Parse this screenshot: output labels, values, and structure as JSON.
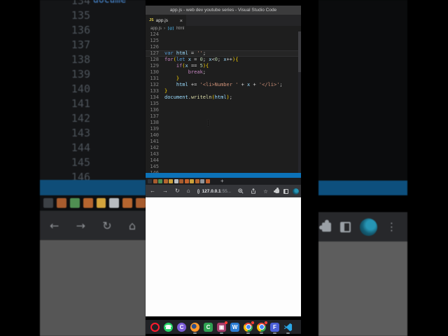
{
  "window": {
    "title": "app.js - web dev youtube series - Visual Studio Code"
  },
  "vscode": {
    "tab": {
      "badge": "JS",
      "label": "app.js",
      "close": "×"
    },
    "breadcrumb": {
      "file": "app.js",
      "sep": "›",
      "symbol_icon": "[@]",
      "symbol": "html"
    },
    "status_color": "#0c72b8",
    "editor": {
      "cursor_line": 127,
      "lines": [
        {
          "n": 124,
          "tokens": []
        },
        {
          "n": 125,
          "tokens": []
        },
        {
          "n": 126,
          "tokens": []
        },
        {
          "n": 127,
          "tokens": [
            [
              "k",
              "var "
            ],
            [
              "v",
              "html"
            ],
            [
              "d",
              " = "
            ],
            [
              "s",
              "''"
            ],
            [
              "d",
              ";"
            ]
          ]
        },
        {
          "n": 128,
          "tokens": [
            [
              "c",
              "for"
            ],
            [
              "b",
              "("
            ],
            [
              "k",
              "let "
            ],
            [
              "v",
              "x"
            ],
            [
              "d",
              " = "
            ],
            [
              "n",
              "0"
            ],
            [
              "d",
              "; "
            ],
            [
              "v",
              "x"
            ],
            [
              "d",
              "<"
            ],
            [
              "n",
              "0"
            ],
            [
              "d",
              "; "
            ],
            [
              "v",
              "x"
            ],
            [
              "d",
              "++"
            ],
            [
              "b",
              "){"
            ]
          ]
        },
        {
          "n": 129,
          "tokens": [
            [
              "d",
              "    "
            ],
            [
              "c",
              "if"
            ],
            [
              "b",
              "("
            ],
            [
              "v",
              "x"
            ],
            [
              "d",
              " == "
            ],
            [
              "n",
              "5"
            ],
            [
              "b",
              "){"
            ]
          ]
        },
        {
          "n": 130,
          "tokens": [
            [
              "d",
              "        "
            ],
            [
              "c",
              "break"
            ],
            [
              "d",
              ";"
            ]
          ]
        },
        {
          "n": 131,
          "tokens": [
            [
              "d",
              "    "
            ],
            [
              "b",
              "}"
            ]
          ]
        },
        {
          "n": 132,
          "tokens": [
            [
              "d",
              "    "
            ],
            [
              "v",
              "html"
            ],
            [
              "d",
              " += "
            ],
            [
              "s",
              "'<li>Number '"
            ],
            [
              "d",
              " + "
            ],
            [
              "v",
              "x"
            ],
            [
              "d",
              " + "
            ],
            [
              "s",
              "'</li>'"
            ],
            [
              "d",
              ";"
            ]
          ]
        },
        {
          "n": 133,
          "tokens": [
            [
              "b",
              "}"
            ]
          ]
        },
        {
          "n": 134,
          "tokens": [
            [
              "v",
              "document"
            ],
            [
              "d",
              "."
            ],
            [
              "f",
              "writeln"
            ],
            [
              "b",
              "("
            ],
            [
              "v",
              "html"
            ],
            [
              "b",
              ")"
            ],
            [
              "d",
              ";"
            ]
          ]
        },
        {
          "n": 135,
          "tokens": []
        },
        {
          "n": 136,
          "tokens": []
        },
        {
          "n": 137,
          "tokens": []
        },
        {
          "n": 138,
          "tokens": []
        },
        {
          "n": 139,
          "tokens": []
        },
        {
          "n": 140,
          "tokens": []
        },
        {
          "n": 141,
          "tokens": []
        },
        {
          "n": 142,
          "tokens": []
        },
        {
          "n": 143,
          "tokens": []
        },
        {
          "n": 144,
          "tokens": []
        },
        {
          "n": 145,
          "tokens": []
        },
        {
          "n": 146,
          "tokens": []
        }
      ]
    }
  },
  "browser": {
    "tabs": {
      "new_tab": "+",
      "favicon_colors": [
        "#2f3338",
        "#a85c2e",
        "#4f8f52",
        "#b5652f",
        "#caa03a",
        "#b8bcc0",
        "#a85c2e",
        "#c2622e",
        "#caa03a",
        "#b5652f",
        "#8f9398",
        "#c2622e"
      ]
    },
    "toolbar": {
      "back": "←",
      "forward": "→",
      "reload": "↻",
      "home": "⌂",
      "info": "i",
      "url_host": "127.0.0.1",
      "url_tail": ":55...",
      "bookmark": "☆",
      "menu": "⋮"
    }
  },
  "taskbar": {
    "icons": [
      {
        "name": "opera",
        "style": "ring",
        "color": "#ff1b2d",
        "glyph": "",
        "running": false,
        "badge": false
      },
      {
        "name": "whatsapp",
        "style": "circle",
        "color": "#25d366",
        "glyph": "☎",
        "running": false,
        "badge": false
      },
      {
        "name": "app-c",
        "style": "circle",
        "color": "#7b5cd6",
        "glyph": "C",
        "running": false,
        "badge": false
      },
      {
        "name": "firefox",
        "style": "firefox",
        "color": "",
        "glyph": "",
        "running": true,
        "badge": false
      },
      {
        "name": "camtasia",
        "style": "square",
        "color": "#2fa152",
        "glyph": "C",
        "running": false,
        "badge": false
      },
      {
        "name": "media-app",
        "style": "square",
        "color": "#a73a68",
        "glyph": "▣",
        "running": true,
        "badge": true
      },
      {
        "name": "word",
        "style": "square",
        "color": "#2b7cd3",
        "glyph": "W",
        "running": false,
        "badge": false
      },
      {
        "name": "chrome",
        "style": "chrome",
        "color": "",
        "glyph": "",
        "running": true,
        "badge": true
      },
      {
        "name": "chrome-2",
        "style": "chrome",
        "color": "",
        "glyph": "",
        "running": true,
        "badge": true
      },
      {
        "name": "f-app",
        "style": "square",
        "color": "#4a5fd7",
        "glyph": "F",
        "running": true,
        "badge": false
      },
      {
        "name": "vscode",
        "style": "vscode",
        "color": "#2aa7e8",
        "glyph": "",
        "running": true,
        "badge": false
      }
    ]
  },
  "background": {
    "left": {
      "code_snippet": "docume",
      "line_numbers": [
        134,
        135,
        136,
        137,
        138,
        139,
        140,
        141,
        142,
        143,
        144,
        145,
        146
      ],
      "favicon_colors": [
        "#3c4045",
        "#a85c2e",
        "#4f8f52",
        "#b5652f",
        "#d3a43c",
        "#b8bcc0",
        "#b5652f",
        "#a85c2e"
      ],
      "toolbar_icons": {
        "back": "←",
        "forward": "→",
        "reload": "↻",
        "home": "⌂"
      }
    },
    "right": {
      "menu": "⋮"
    }
  }
}
